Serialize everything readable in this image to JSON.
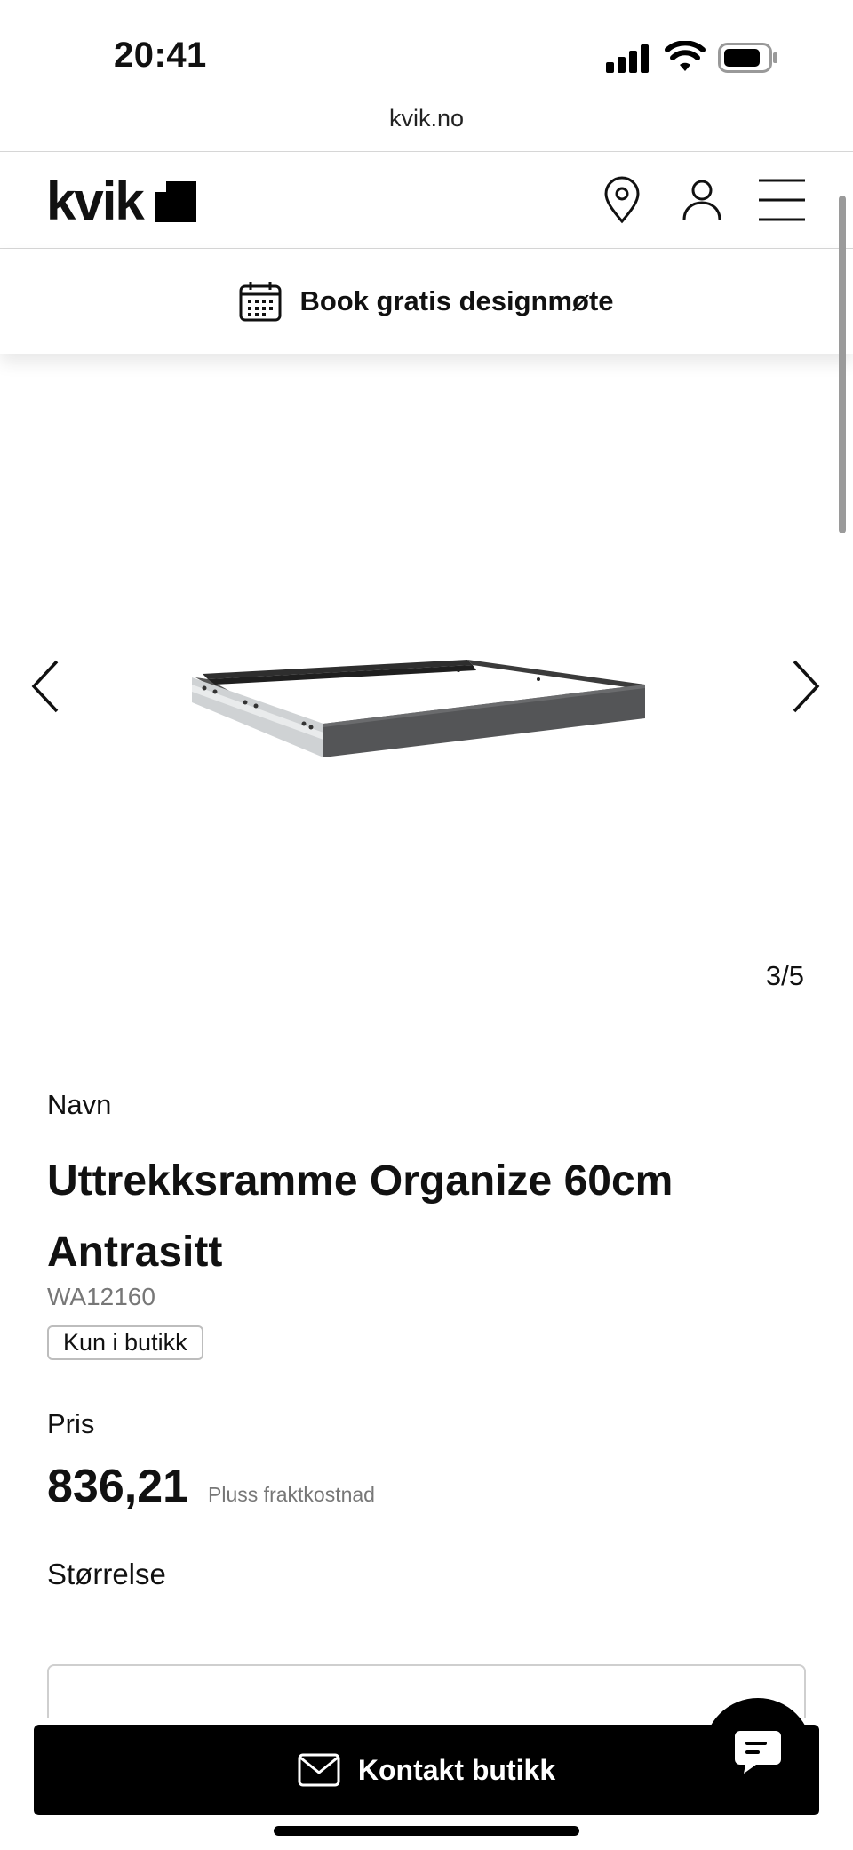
{
  "status_bar": {
    "time": "20:41"
  },
  "browser": {
    "url": "kvik.no"
  },
  "header": {
    "logo_text": "kvik",
    "icons": [
      "location-pin-icon",
      "account-icon",
      "hamburger-menu-icon"
    ]
  },
  "booking_banner": {
    "label": "Book gratis designmøte",
    "icon": "calendar-icon"
  },
  "gallery": {
    "counter": "3/5",
    "current": 3,
    "total": 5
  },
  "product": {
    "name_label": "Navn",
    "title": "Uttrekksramme Organize 60cm Antrasitt",
    "sku": "WA12160",
    "availability_badge": "Kun i butikk",
    "price_label": "Pris",
    "price": "836,21",
    "price_note": "Pluss fraktkostnad",
    "size_label": "Størrelse"
  },
  "cta": {
    "label": "Kontakt butikk",
    "icon": "mail-icon"
  },
  "chat": {
    "icon": "chat-icon"
  },
  "colors": {
    "text": "#111111",
    "muted": "#777777",
    "cta_background": "#000000",
    "cta_text": "#ffffff",
    "border": "#d6d6d6"
  }
}
